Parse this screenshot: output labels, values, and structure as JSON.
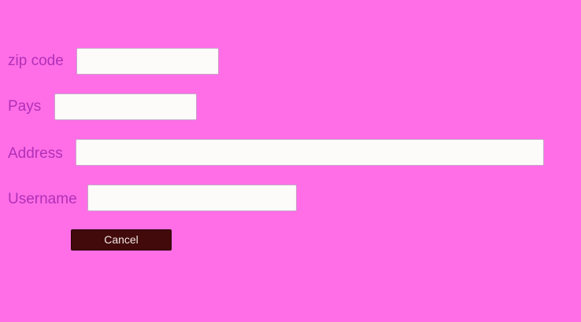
{
  "form": {
    "zip": {
      "label": "zip code",
      "value": "",
      "placeholder": ""
    },
    "pays": {
      "label": "Pays",
      "value": "",
      "placeholder": ""
    },
    "address": {
      "label": "Address",
      "value": "",
      "placeholder": ""
    },
    "username": {
      "label": "Username",
      "value": "",
      "placeholder": ""
    },
    "cancel_label": "Cancel"
  },
  "colors": {
    "background": "#ff6ee6",
    "label_text": "#b030b8",
    "input_background": "#fdfafa",
    "cancel_button": "#420a0a",
    "cancel_text": "#f3e6e6"
  }
}
